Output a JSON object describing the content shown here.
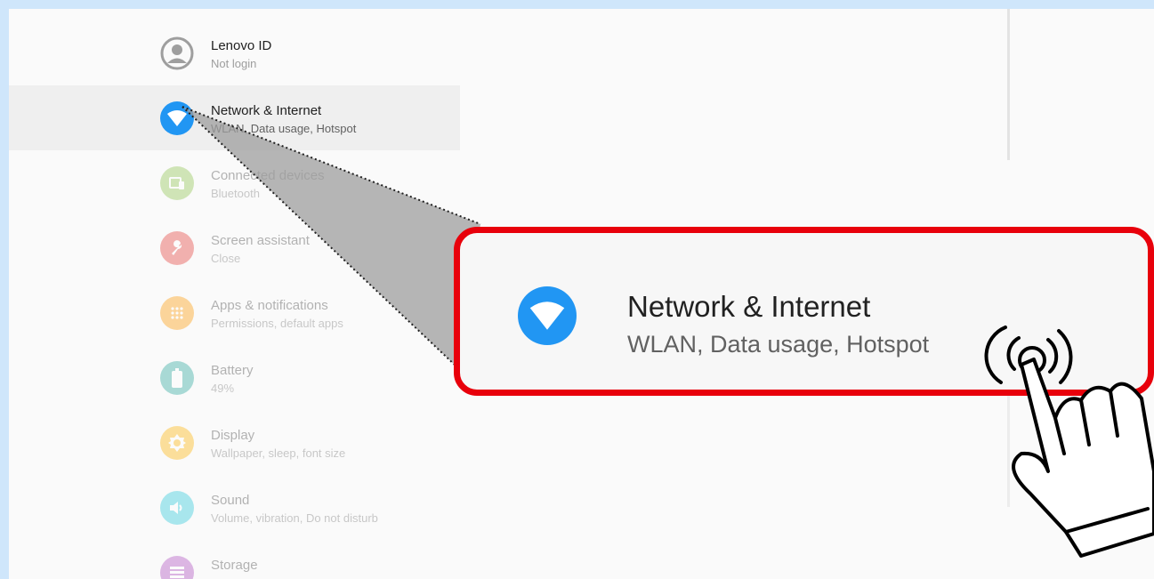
{
  "settings": {
    "items": [
      {
        "title": "Lenovo ID",
        "subtitle": "Not login",
        "icon": "account-icon",
        "color": "#9e9e9e"
      },
      {
        "title": "Network & Internet",
        "subtitle": "WLAN, Data usage, Hotspot",
        "icon": "wifi-icon",
        "color": "#2196f3"
      },
      {
        "title": "Connected devices",
        "subtitle": "Bluetooth",
        "icon": "devices-icon",
        "color": "#8bc34a"
      },
      {
        "title": "Screen assistant",
        "subtitle": "Close",
        "icon": "wrench-icon",
        "color": "#e53935"
      },
      {
        "title": "Apps & notifications",
        "subtitle": "Permissions, default apps",
        "icon": "apps-grid-icon",
        "color": "#ff9800"
      },
      {
        "title": "Battery",
        "subtitle": "49%",
        "icon": "battery-icon",
        "color": "#26a69a"
      },
      {
        "title": "Display",
        "subtitle": "Wallpaper, sleep, font size",
        "icon": "brightness-icon",
        "color": "#ffb300"
      },
      {
        "title": "Sound",
        "subtitle": "Volume, vibration, Do not disturb",
        "icon": "volume-icon",
        "color": "#26c6da"
      },
      {
        "title": "Storage",
        "subtitle": "",
        "icon": "storage-icon",
        "color": "#ab47bc"
      }
    ]
  },
  "callout": {
    "title": "Network & Internet",
    "subtitle": "WLAN, Data usage, Hotspot",
    "icon": "wifi-icon",
    "border_color": "#e8000b"
  },
  "gesture": {
    "icon": "tap-hand-icon"
  }
}
